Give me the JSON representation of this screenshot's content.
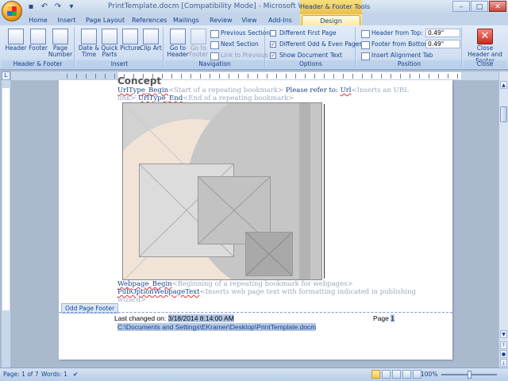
{
  "window": {
    "title": "PrintTemplate.docm [Compatibility Mode] - Microsoft Word",
    "context_title": "Header & Footer Tools"
  },
  "qat": {
    "save_icon": "floppy-icon",
    "undo_icon": "undo-icon",
    "redo_icon": "redo-icon",
    "more_icon": "qat-more-icon"
  },
  "tabs": [
    {
      "label": "Home"
    },
    {
      "label": "Insert"
    },
    {
      "label": "Page Layout"
    },
    {
      "label": "References"
    },
    {
      "label": "Mailings"
    },
    {
      "label": "Review"
    },
    {
      "label": "View"
    },
    {
      "label": "Add-Ins"
    },
    {
      "label": "Design"
    }
  ],
  "ribbon": {
    "header_footer": {
      "label": "Header & Footer",
      "header": "Header",
      "footer": "Footer",
      "page_number": "Page Number"
    },
    "insert": {
      "label": "Insert",
      "date_time": "Date & Time",
      "quick_parts": "Quick Parts",
      "picture": "Picture",
      "clip_art": "Clip Art"
    },
    "navigation": {
      "label": "Navigation",
      "goto_header": "Go to Header",
      "goto_footer": "Go to Footer",
      "prev_section": "Previous Section",
      "next_section": "Next Section",
      "link_prev": "Link to Previous"
    },
    "options": {
      "label": "Options",
      "diff_first": "Different First Page",
      "diff_odd_even": "Different Odd & Even Pages",
      "show_doc_text": "Show Document Text",
      "diff_first_checked": false,
      "diff_odd_even_checked": true,
      "show_doc_text_checked": true
    },
    "position": {
      "label": "Position",
      "header_from_top": "Header from Top:",
      "header_from_top_val": "0.49\"",
      "footer_from_bottom": "Footer from Bottom:",
      "footer_from_bottom_val": "0.49\"",
      "insert_alignment_tab": "Insert Alignment Tab"
    },
    "close": {
      "label": "Close",
      "close_btn": "Close Header and Footer"
    }
  },
  "document": {
    "heading_fragment": "Concept",
    "line1_prefix": "UrlType_Begin",
    "line1_gray": "<Start of a repeating bookmark>",
    "line1_text": "Please refer to:",
    "line1_url": "Url",
    "line1_url_gray": "<Inserts an URL",
    "line2_gray_a": "link>",
    "line2_end": "UrlType_End",
    "line2_gray_b": "<End of a repeating bookmark>",
    "webpage_begin": "Webpage_Begin",
    "webpage_begin_gray": "<Beginning of a repeating bookmark for webpages>",
    "pub_option": "PubOptionWebpageText",
    "pub_option_gray": "<Inserts web page text with formatting indicated in publishing",
    "pub_option_gray2": "wizard>"
  },
  "footer": {
    "tag": "Odd Page Footer",
    "last_changed_label": "Last changed on:",
    "last_changed_value": "3/18/2014 8:14:00 AM",
    "page_label": "Page",
    "page_value": "1",
    "path": "C:\\Documents and Settings\\EKramer\\Desktop\\PrintTemplate.docm"
  },
  "statusbar": {
    "page": "Page: 1 of 7",
    "words": "Words: 1",
    "zoom": "100%"
  },
  "colors": {
    "accent": "#15428b",
    "ribbon": "#d1dff2",
    "context_tab": "#f3d97a"
  }
}
